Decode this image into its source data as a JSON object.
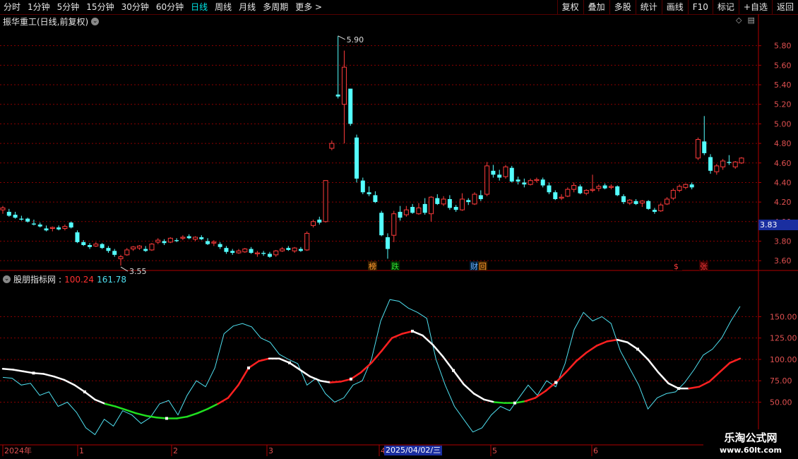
{
  "toolbar": {
    "periods": [
      "分时",
      "1分钟",
      "5分钟",
      "15分钟",
      "30分钟",
      "60分钟",
      "日线",
      "周线",
      "月线",
      "多周期",
      "更多 >"
    ],
    "active_period": "日线",
    "buttons": [
      "复权",
      "叠加",
      "多股",
      "统计",
      "画线",
      "F10",
      "标记",
      "+自选",
      "返回"
    ]
  },
  "main_chart": {
    "title": "振华重工(日线,前复权)",
    "y_ticks": [
      "5.80",
      "5.60",
      "5.40",
      "5.20",
      "5.00",
      "4.80",
      "4.60",
      "4.40",
      "4.20",
      "4.00",
      "3.80",
      "3.60"
    ],
    "current_price": "3.83",
    "high_label": "5.90",
    "low_label": "3.55",
    "event_markers": [
      "榜",
      "跌",
      "财",
      "回",
      "$",
      "张"
    ]
  },
  "indicator": {
    "name": "股朋指标网",
    "value1": "100.24",
    "value2": "161.78",
    "y_ticks": [
      "150.00",
      "125.00",
      "100.00",
      "75.00",
      "50.00"
    ]
  },
  "time_axis": {
    "labels": [
      "2024年",
      "1",
      "2",
      "3",
      "4",
      "5",
      "6"
    ],
    "cursor_date": "2025/04/02/三"
  },
  "watermark": {
    "line1": "乐淘公式网",
    "line2": "www.60lt.com"
  },
  "colors": {
    "up": "#ff3b3b",
    "down": "#54ffff",
    "grid": "#8a0000",
    "axis": "#b00000",
    "ma_white": "#ffffff",
    "ma_red": "#ff2020",
    "ma_green": "#20e020",
    "indicator_cyan": "#4fe0f0"
  },
  "chart_data": [
    {
      "type": "candlestick",
      "title": "振华重工(日线,前复权)",
      "y_range": [
        3.5,
        6.0
      ],
      "ohlc_approx": [
        [
          4.12,
          4.16,
          4.08,
          4.14
        ],
        [
          4.1,
          4.13,
          4.05,
          4.06
        ],
        [
          4.07,
          4.1,
          4.03,
          4.04
        ],
        [
          4.03,
          4.06,
          4.01,
          4.02
        ],
        [
          4.03,
          4.04,
          3.99,
          4.0
        ],
        [
          3.98,
          4.02,
          3.96,
          3.97
        ],
        [
          3.97,
          3.99,
          3.94,
          3.95
        ],
        [
          3.93,
          3.96,
          3.9,
          3.91
        ],
        [
          3.93,
          3.95,
          3.9,
          3.94
        ],
        [
          3.94,
          3.96,
          3.91,
          3.92
        ],
        [
          3.93,
          3.97,
          3.91,
          3.95
        ],
        [
          3.99,
          4.0,
          3.93,
          3.94
        ],
        [
          3.89,
          3.91,
          3.78,
          3.79
        ],
        [
          3.79,
          3.81,
          3.75,
          3.76
        ],
        [
          3.76,
          3.78,
          3.72,
          3.74
        ],
        [
          3.75,
          3.79,
          3.74,
          3.77
        ],
        [
          3.77,
          3.78,
          3.72,
          3.73
        ],
        [
          3.73,
          3.75,
          3.68,
          3.7
        ],
        [
          3.7,
          3.72,
          3.64,
          3.66
        ],
        [
          3.62,
          3.66,
          3.55,
          3.64
        ],
        [
          3.66,
          3.73,
          3.65,
          3.71
        ],
        [
          3.72,
          3.75,
          3.7,
          3.74
        ],
        [
          3.73,
          3.76,
          3.71,
          3.75
        ],
        [
          3.72,
          3.75,
          3.69,
          3.7
        ],
        [
          3.71,
          3.78,
          3.7,
          3.77
        ],
        [
          3.79,
          3.83,
          3.77,
          3.81
        ],
        [
          3.8,
          3.82,
          3.76,
          3.78
        ],
        [
          3.79,
          3.84,
          3.78,
          3.83
        ],
        [
          3.81,
          3.83,
          3.79,
          3.8
        ],
        [
          3.83,
          3.86,
          3.81,
          3.84
        ],
        [
          3.85,
          3.87,
          3.82,
          3.83
        ],
        [
          3.82,
          3.85,
          3.8,
          3.84
        ],
        [
          3.84,
          3.86,
          3.81,
          3.82
        ],
        [
          3.8,
          3.83,
          3.76,
          3.77
        ],
        [
          3.78,
          3.81,
          3.75,
          3.79
        ],
        [
          3.77,
          3.79,
          3.72,
          3.74
        ],
        [
          3.73,
          3.75,
          3.67,
          3.69
        ],
        [
          3.7,
          3.72,
          3.66,
          3.68
        ],
        [
          3.68,
          3.72,
          3.67,
          3.7
        ],
        [
          3.69,
          3.73,
          3.68,
          3.72
        ],
        [
          3.72,
          3.74,
          3.67,
          3.68
        ],
        [
          3.67,
          3.7,
          3.64,
          3.68
        ],
        [
          3.68,
          3.7,
          3.65,
          3.67
        ],
        [
          3.67,
          3.69,
          3.63,
          3.64
        ],
        [
          3.66,
          3.71,
          3.64,
          3.7
        ],
        [
          3.7,
          3.74,
          3.69,
          3.72
        ],
        [
          3.73,
          3.75,
          3.7,
          3.71
        ],
        [
          3.7,
          3.74,
          3.68,
          3.73
        ],
        [
          3.72,
          3.74,
          3.69,
          3.7
        ],
        [
          3.71,
          3.9,
          3.7,
          3.88
        ],
        [
          3.96,
          4.02,
          3.94,
          4.0
        ],
        [
          4.02,
          4.05,
          3.97,
          3.99
        ],
        [
          4.0,
          4.42,
          3.99,
          4.42
        ],
        [
          4.75,
          4.83,
          4.73,
          4.8
        ],
        [
          5.3,
          5.9,
          5.26,
          5.28
        ],
        [
          5.2,
          5.75,
          4.8,
          5.58
        ],
        [
          5.36,
          5.36,
          4.98,
          5.0
        ],
        [
          4.86,
          4.89,
          4.4,
          4.44
        ],
        [
          4.42,
          4.45,
          4.28,
          4.3
        ],
        [
          4.3,
          4.36,
          4.26,
          4.28
        ],
        [
          4.27,
          4.31,
          4.19,
          4.2
        ],
        [
          4.09,
          4.11,
          3.85,
          3.86
        ],
        [
          3.84,
          3.88,
          3.62,
          3.72
        ],
        [
          3.86,
          4.11,
          3.79,
          4.08
        ],
        [
          4.1,
          4.16,
          4.01,
          4.04
        ],
        [
          4.07,
          4.16,
          4.05,
          4.12
        ],
        [
          4.15,
          4.18,
          4.08,
          4.09
        ],
        [
          4.08,
          4.19,
          4.07,
          4.14
        ],
        [
          4.18,
          4.24,
          4.07,
          4.09
        ],
        [
          4.08,
          4.26,
          4.0,
          4.25
        ],
        [
          4.24,
          4.28,
          4.17,
          4.18
        ],
        [
          4.18,
          4.26,
          4.16,
          4.23
        ],
        [
          4.23,
          4.27,
          4.12,
          4.14
        ],
        [
          4.15,
          4.17,
          4.1,
          4.12
        ],
        [
          4.12,
          4.29,
          4.11,
          4.23
        ],
        [
          4.22,
          4.24,
          4.17,
          4.2
        ],
        [
          4.18,
          4.3,
          4.17,
          4.28
        ],
        [
          4.27,
          4.32,
          4.21,
          4.23
        ],
        [
          4.28,
          4.61,
          4.26,
          4.57
        ],
        [
          4.52,
          4.58,
          4.45,
          4.48
        ],
        [
          4.48,
          4.53,
          4.42,
          4.45
        ],
        [
          4.46,
          4.58,
          4.44,
          4.56
        ],
        [
          4.55,
          4.57,
          4.4,
          4.41
        ],
        [
          4.43,
          4.46,
          4.38,
          4.41
        ],
        [
          4.4,
          4.44,
          4.35,
          4.38
        ],
        [
          4.38,
          4.44,
          4.37,
          4.42
        ],
        [
          4.42,
          4.45,
          4.4,
          4.43
        ],
        [
          4.43,
          4.45,
          4.35,
          4.37
        ],
        [
          4.37,
          4.4,
          4.28,
          4.3
        ],
        [
          4.3,
          4.32,
          4.22,
          4.23
        ],
        [
          4.24,
          4.28,
          4.22,
          4.25
        ],
        [
          4.26,
          4.35,
          4.25,
          4.33
        ],
        [
          4.33,
          4.4,
          4.3,
          4.37
        ],
        [
          4.36,
          4.38,
          4.28,
          4.29
        ],
        [
          4.29,
          4.33,
          4.27,
          4.32
        ],
        [
          4.32,
          4.48,
          4.3,
          4.33
        ],
        [
          4.34,
          4.38,
          4.31,
          4.36
        ],
        [
          4.37,
          4.39,
          4.33,
          4.34
        ],
        [
          4.35,
          4.38,
          4.33,
          4.36
        ],
        [
          4.36,
          4.37,
          4.26,
          4.27
        ],
        [
          4.26,
          4.28,
          4.18,
          4.2
        ],
        [
          4.19,
          4.23,
          4.17,
          4.22
        ],
        [
          4.21,
          4.23,
          4.17,
          4.18
        ],
        [
          4.19,
          4.22,
          4.15,
          4.21
        ],
        [
          4.21,
          4.22,
          4.12,
          4.13
        ],
        [
          4.12,
          4.14,
          4.08,
          4.1
        ],
        [
          4.11,
          4.19,
          4.1,
          4.17
        ],
        [
          4.18,
          4.25,
          4.17,
          4.23
        ],
        [
          4.24,
          4.34,
          4.22,
          4.32
        ],
        [
          4.32,
          4.38,
          4.3,
          4.36
        ],
        [
          4.35,
          4.39,
          4.33,
          4.38
        ],
        [
          4.38,
          4.4,
          4.33,
          4.35
        ],
        [
          4.65,
          4.86,
          4.63,
          4.84
        ],
        [
          4.82,
          5.08,
          4.68,
          4.7
        ],
        [
          4.66,
          4.69,
          4.49,
          4.52
        ],
        [
          4.51,
          4.59,
          4.48,
          4.57
        ],
        [
          4.56,
          4.64,
          4.53,
          4.62
        ],
        [
          4.61,
          4.68,
          4.58,
          4.6
        ],
        [
          4.56,
          4.62,
          4.54,
          4.61
        ],
        [
          4.6,
          4.66,
          4.59,
          4.65
        ]
      ]
    },
    {
      "type": "line",
      "title": "股朋指标网",
      "series": [
        {
          "name": "100.24",
          "values": [
            89,
            88,
            86,
            84,
            83,
            80,
            76,
            70,
            62,
            53,
            48,
            45,
            41,
            37,
            34,
            32,
            31,
            31,
            33,
            37,
            42,
            48,
            55,
            70,
            90,
            98,
            101,
            101,
            96,
            88,
            80,
            75,
            73,
            74,
            77,
            85,
            96,
            110,
            125,
            130,
            133,
            128,
            117,
            103,
            87,
            71,
            60,
            53,
            50,
            49,
            49,
            51,
            55,
            63,
            73,
            85,
            98,
            108,
            116,
            121,
            123,
            120,
            112,
            100,
            85,
            72,
            66,
            66,
            68,
            74,
            85,
            96,
            101
          ]
        },
        {
          "name": "161.78",
          "values": [
            79,
            78,
            70,
            72,
            58,
            62,
            45,
            50,
            38,
            20,
            12,
            30,
            22,
            40,
            35,
            25,
            32,
            48,
            52,
            35,
            58,
            75,
            68,
            90,
            130,
            139,
            142,
            138,
            125,
            120,
            106,
            100,
            95,
            70,
            78,
            60,
            50,
            55,
            70,
            75,
            100,
            145,
            170,
            168,
            160,
            155,
            148,
            100,
            70,
            45,
            30,
            15,
            20,
            35,
            45,
            40,
            55,
            70,
            58,
            75,
            68,
            95,
            135,
            155,
            145,
            150,
            142,
            110,
            90,
            70,
            42,
            55,
            60,
            62,
            73,
            88,
            105,
            112,
            125,
            145,
            162
          ]
        }
      ]
    }
  ]
}
